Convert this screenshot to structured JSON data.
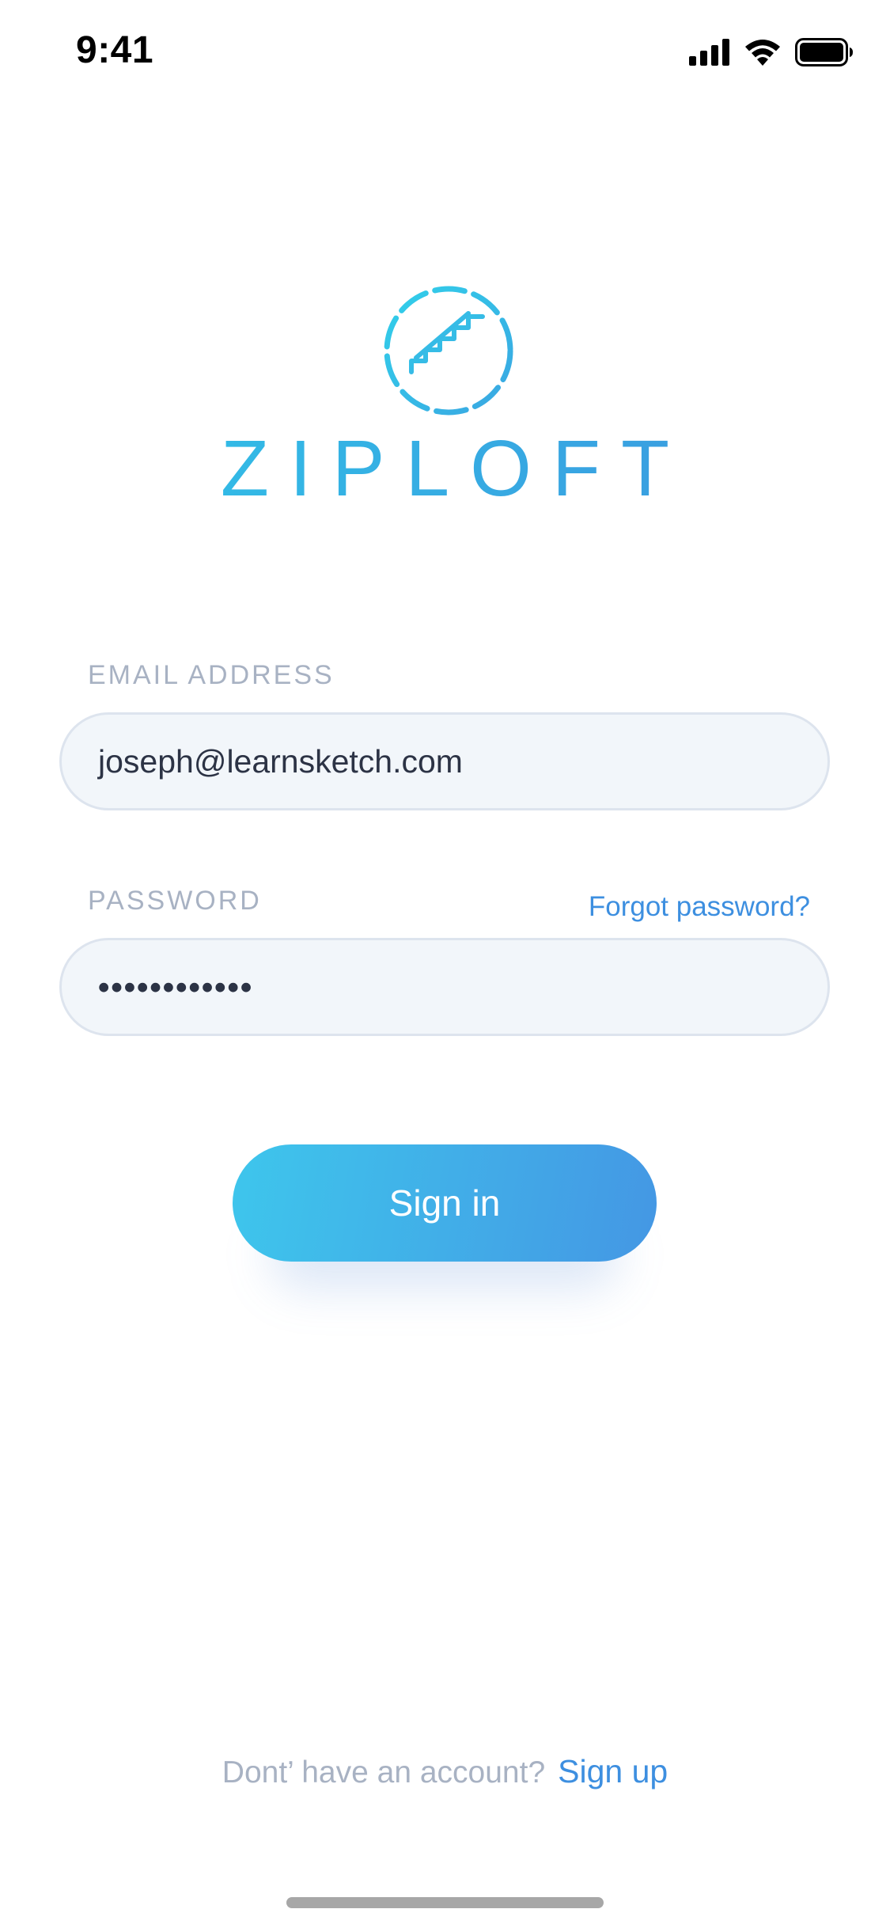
{
  "status_bar": {
    "time": "9:41",
    "icons": [
      "cellular-signal-icon",
      "wifi-icon",
      "battery-icon"
    ]
  },
  "brand": {
    "name": "ZIPLOFT",
    "logo_icon": "staircase-icon",
    "gradient_start": "#2fc6e8",
    "gradient_end": "#3d93de"
  },
  "form": {
    "email_label": "EMAIL ADDRESS",
    "email_value": "joseph@learnsketch.com",
    "password_label": "PASSWORD",
    "password_value": "••••••••••••",
    "forgot_password": "Forgot password?",
    "sign_in": "Sign in"
  },
  "footer": {
    "prompt": "Dont’ have an account?",
    "sign_up": "Sign up"
  },
  "colors": {
    "accent": "#3d8fe0",
    "label": "#a8b2c3",
    "field_bg": "#f2f6fa",
    "field_border": "#dde4ee",
    "text": "#2c3345"
  }
}
